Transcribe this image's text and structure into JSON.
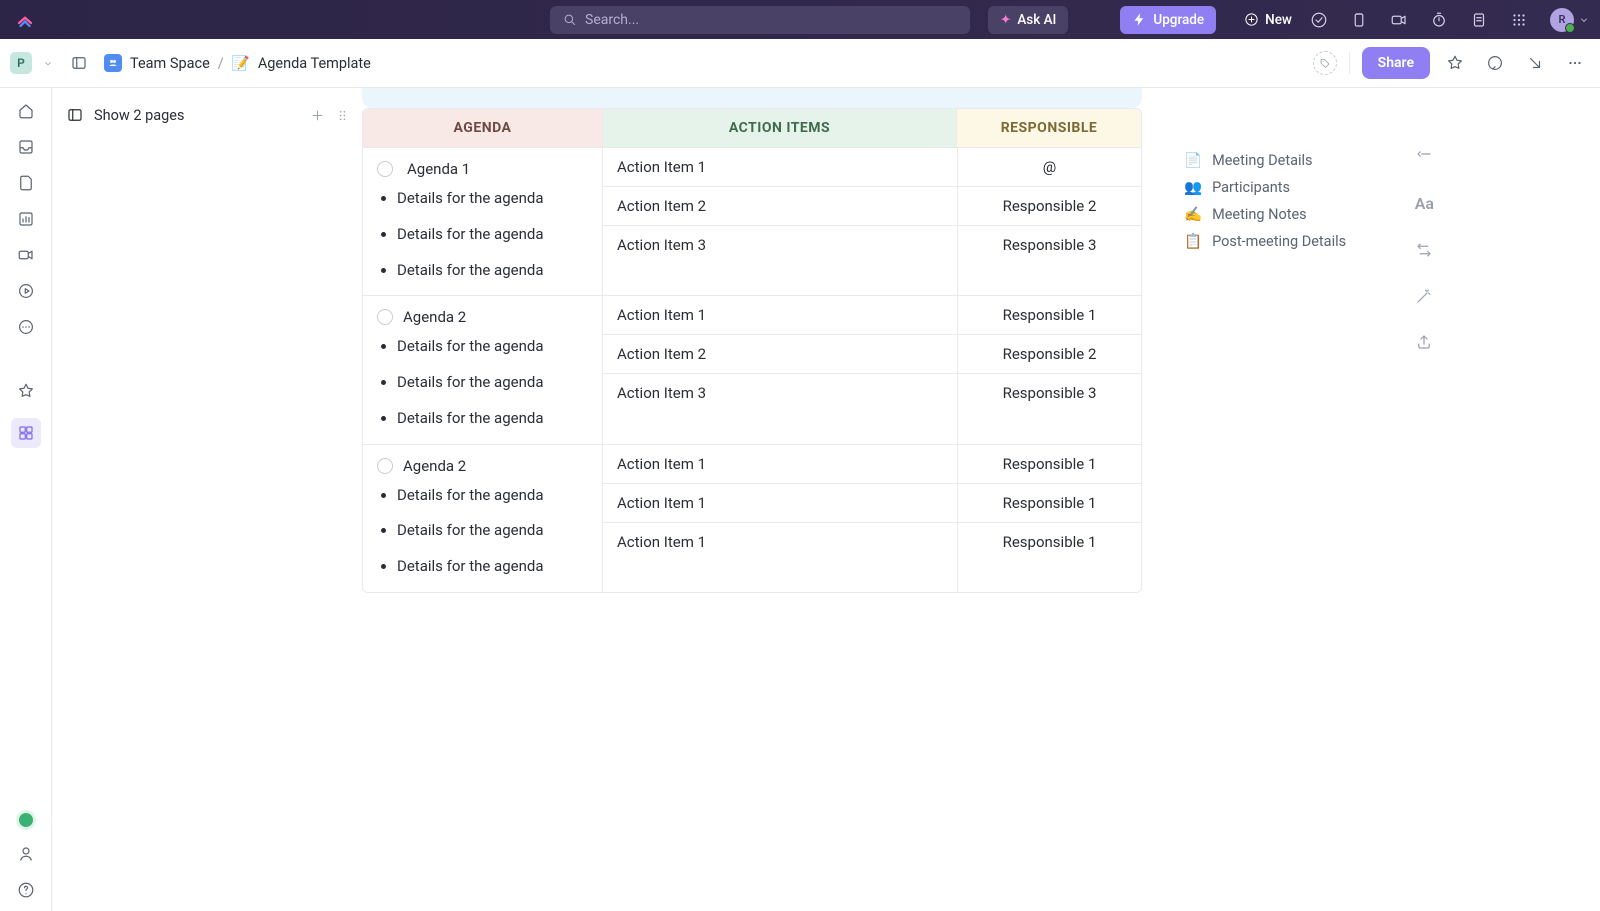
{
  "topbar": {
    "search_placeholder": "Search...",
    "ask_ai": "Ask AI",
    "upgrade": "Upgrade",
    "new": "New",
    "avatar_initial": "R"
  },
  "breadcrumb": {
    "workspace_initial": "P",
    "space": "Team Space",
    "doc_emoji": "📝",
    "doc": "Agenda Template",
    "share": "Share"
  },
  "explorer": {
    "show_pages": "Show 2 pages"
  },
  "table": {
    "headers": {
      "agenda": "AGENDA",
      "actions": "ACTION ITEMS",
      "resp": "RESPONSIBLE"
    },
    "rows": [
      {
        "title": "Agenda 1",
        "details": [
          "Details for the agen­da",
          "Details for the agen­da",
          "Details for the agen­da"
        ],
        "items": [
          {
            "action": "Action Item 1",
            "resp": "@"
          },
          {
            "action": "Action Item 2",
            "resp": "Responsible 2"
          },
          {
            "action": "Action Item 3",
            "resp": "Responsible 3"
          }
        ]
      },
      {
        "title": "Agenda 2",
        "details": [
          "Details for the agen­da",
          "Details for the agen­da",
          "Details for the agen­da"
        ],
        "items": [
          {
            "action": "Action Item 1",
            "resp": "Responsible 1"
          },
          {
            "action": "Action Item 2",
            "resp": "Responsible 2"
          },
          {
            "action": "Action Item 3",
            "resp": "Responsible 3"
          }
        ]
      },
      {
        "title": "Agenda 2",
        "details": [
          "Details for the agen­da",
          "Details for the agen­da",
          "Details for the agen­da"
        ],
        "items": [
          {
            "action": "Action Item 1",
            "resp": "Responsible 1"
          },
          {
            "action": "Action Item 1",
            "resp": "Responsible 1"
          },
          {
            "action": "Action Item 1",
            "resp": "Responsible 1"
          }
        ]
      }
    ]
  },
  "outline": [
    {
      "emoji": "📄",
      "label": "Meeting Details"
    },
    {
      "emoji": "👥",
      "label": "Participants"
    },
    {
      "emoji": "✍️",
      "label": "Meeting Notes"
    },
    {
      "emoji": "📋",
      "label": "Post-meeting Details"
    }
  ]
}
